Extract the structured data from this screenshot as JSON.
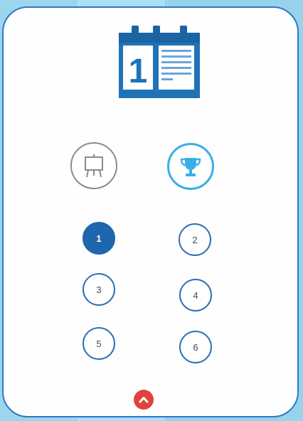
{
  "calendar": {
    "day_number": "1",
    "icon": "calendar-icon"
  },
  "modes": [
    {
      "icon": "easel-icon",
      "active": false
    },
    {
      "icon": "trophy-icon",
      "active": true
    }
  ],
  "numbers": [
    {
      "label": "1",
      "active": true
    },
    {
      "label": "2",
      "active": false
    },
    {
      "label": "3",
      "active": false
    },
    {
      "label": "4",
      "active": false
    },
    {
      "label": "5",
      "active": false
    },
    {
      "label": "6",
      "active": false
    }
  ],
  "scroll_up": {
    "icon": "chevron-up-icon"
  },
  "colors": {
    "primary_blue": "#1e66ad",
    "accent_cyan": "#3aaee6",
    "neutral_grey": "#908a85",
    "alert_red": "#e0433f"
  }
}
